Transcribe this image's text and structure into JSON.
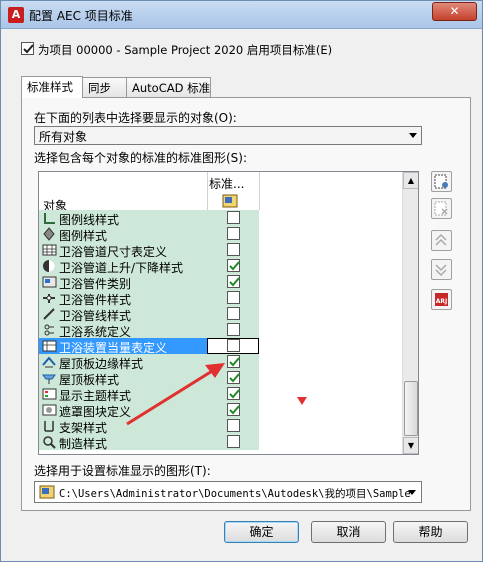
{
  "window": {
    "title": "配置 AEC 项目标准",
    "close_glyph": "✕",
    "app_icon_letter": "A"
  },
  "project_check": {
    "checked": true,
    "label": "为项目 00000 - Sample Project 2020 启用项目标准(E)"
  },
  "tabs": [
    {
      "label": "标准样式",
      "active": true
    },
    {
      "label": "同步",
      "active": false
    },
    {
      "label": "AutoCAD 标准",
      "active": false
    }
  ],
  "object_list_label": "在下面的列表中选择要显示的对象(O):",
  "object_select": {
    "value": "所有对象"
  },
  "standards_label": "选择包含每个对象的标准的标准图形(S):",
  "grid": {
    "col_object": "对象",
    "col_standard": "标准...",
    "rows": [
      {
        "name": "图例线样式",
        "icon": "legend-line-icon",
        "checked": false,
        "selected": false
      },
      {
        "name": "图例样式",
        "icon": "legend-icon",
        "checked": false,
        "selected": false
      },
      {
        "name": "卫浴管道尺寸表定义",
        "icon": "table-icon",
        "checked": false,
        "selected": false
      },
      {
        "name": "卫浴管道上升/下降样式",
        "icon": "rise-drop-icon",
        "checked": true,
        "selected": false
      },
      {
        "name": "卫浴管件类别",
        "icon": "fitting-category-icon",
        "checked": true,
        "selected": false
      },
      {
        "name": "卫浴管件样式",
        "icon": "fitting-icon",
        "checked": false,
        "selected": false
      },
      {
        "name": "卫浴管线样式",
        "icon": "pipe-line-icon",
        "checked": false,
        "selected": false
      },
      {
        "name": "卫浴系统定义",
        "icon": "system-icon",
        "checked": false,
        "selected": false
      },
      {
        "name": "卫浴装置当量表定义",
        "icon": "fixture-unit-icon",
        "checked": false,
        "selected": true
      },
      {
        "name": "屋顶板边缘样式",
        "icon": "roof-edge-icon",
        "checked": true,
        "selected": false
      },
      {
        "name": "屋顶板样式",
        "icon": "roof-slab-icon",
        "checked": true,
        "selected": false
      },
      {
        "name": "显示主题样式",
        "icon": "display-theme-icon",
        "checked": true,
        "selected": false
      },
      {
        "name": "遮罩图块定义",
        "icon": "mask-block-icon",
        "checked": true,
        "selected": false
      },
      {
        "name": "支架样式",
        "icon": "support-icon",
        "checked": false,
        "selected": false
      },
      {
        "name": "制造样式",
        "icon": "fabrication-icon",
        "checked": false,
        "selected": false
      }
    ]
  },
  "display_label": "选择用于设置标准显示的图形(T):",
  "display_path": "C:\\Users\\Administrator\\Documents\\Autodesk\\我的项目\\Sample",
  "buttons": {
    "ok": "确定",
    "cancel": "取消",
    "help": "帮助"
  },
  "colors": {
    "row_band": "#cde8d8",
    "selection": "#3399ff",
    "accent_arrow": "#e03030"
  }
}
